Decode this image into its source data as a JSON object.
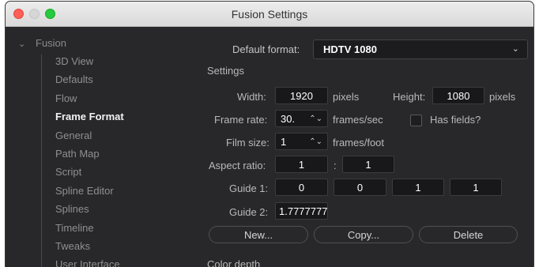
{
  "window": {
    "title": "Fusion Settings"
  },
  "sidebar": {
    "root": "Fusion",
    "items": [
      {
        "label": "3D View"
      },
      {
        "label": "Defaults"
      },
      {
        "label": "Flow"
      },
      {
        "label": "Frame Format",
        "active": true
      },
      {
        "label": "General"
      },
      {
        "label": "Path Map"
      },
      {
        "label": "Script"
      },
      {
        "label": "Spline Editor"
      },
      {
        "label": "Splines"
      },
      {
        "label": "Timeline"
      },
      {
        "label": "Tweaks"
      },
      {
        "label": "User Interface"
      }
    ]
  },
  "main": {
    "default_format_label": "Default format:",
    "default_format_value": "HDTV 1080",
    "settings_header": "Settings",
    "width_label": "Width:",
    "width_value": "1920",
    "width_unit": "pixels",
    "height_label": "Height:",
    "height_value": "1080",
    "height_unit": "pixels",
    "frame_rate_label": "Frame rate:",
    "frame_rate_value": "30.",
    "frame_rate_unit": "frames/sec",
    "has_fields_label": "Has fields?",
    "has_fields_checked": false,
    "film_size_label": "Film size:",
    "film_size_value": "1",
    "film_size_unit": "frames/foot",
    "aspect_ratio_label": "Aspect ratio:",
    "aspect_x": "1",
    "aspect_sep": ":",
    "aspect_y": "1",
    "guide1_label": "Guide 1:",
    "guide1_values": [
      "0",
      "0",
      "1",
      "1"
    ],
    "guide2_label": "Guide 2:",
    "guide2_value": "1.7777777",
    "new_button": "New...",
    "copy_button": "Copy...",
    "delete_button": "Delete",
    "color_depth_header": "Color depth"
  }
}
